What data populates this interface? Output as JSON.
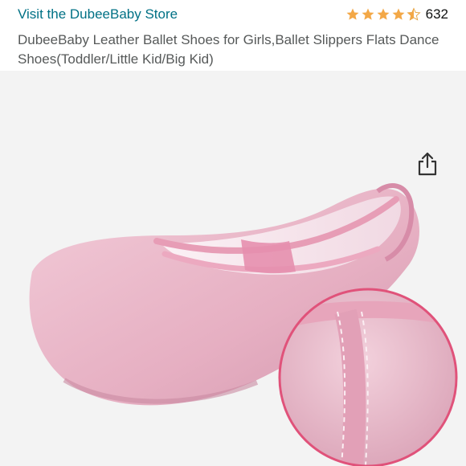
{
  "store": {
    "link_text": "Visit the DubeeBaby Store"
  },
  "rating": {
    "stars": 4.5,
    "count": "632",
    "star_color": "#F3A847"
  },
  "product": {
    "title": "DubeeBaby Leather Ballet Shoes for Girls,Ballet Slippers Flats Dance Shoes(Toddler/Little Kid/Big Kid)"
  },
  "gallery": {
    "share_icon": "share-icon",
    "shoe_color": "#E8B4C6",
    "background": "#F3F3F3"
  },
  "colors": {
    "link": "#007185",
    "title": "#565959",
    "zoom_ring": "#E0527A"
  }
}
